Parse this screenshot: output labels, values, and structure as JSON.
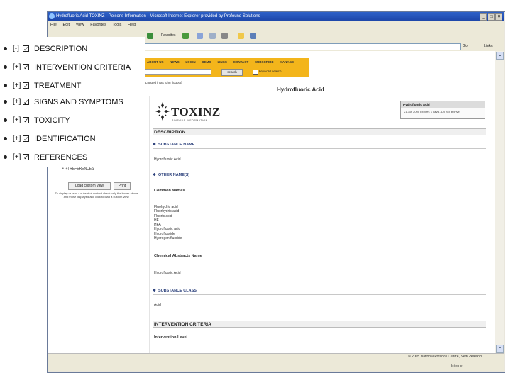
{
  "window": {
    "title": "Hydrofluoric Acid TOXINZ - Poisons Information - Microsoft Internet Explorer provided by Profound Solutions",
    "controls": [
      "_",
      "□",
      "X"
    ]
  },
  "menubar": [
    "File",
    "Edit",
    "View",
    "Favorites",
    "Tools",
    "Help"
  ],
  "toolbar": {
    "favorites": "Favorites"
  },
  "addressbar": {
    "go": "Go",
    "links": "Links"
  },
  "site_nav": [
    "ABOUT US",
    "NEWS",
    "LOGIN",
    "DEMO",
    "LINKS",
    "CONTACT",
    "SUBSCRIBE",
    "MANAGE"
  ],
  "search": {
    "button": "search",
    "keyword_label": "keyword search"
  },
  "logged_in": "Logged in as john [logout]",
  "page_title": "Hydrofluoric Acid",
  "left_panel": {
    "last_item_prefix": "[+]",
    "last_item_label": "REFERENCES",
    "load_button": "Load custom view",
    "print_button": "Print",
    "help_text": "To display or print a subset of content check only the boxes above and those displayed and click to load a custom view."
  },
  "overlay": {
    "items": [
      {
        "expander": "[-]",
        "label": "DESCRIPTION",
        "checked": true
      },
      {
        "expander": "[+]",
        "label": "INTERVENTION CRITERIA",
        "checked": true
      },
      {
        "expander": "[+]",
        "label": "TREATMENT",
        "checked": true
      },
      {
        "expander": "[+]",
        "label": "SIGNS AND SYMPTOMS",
        "checked": true
      },
      {
        "expander": "[+]",
        "label": "TOXICITY",
        "checked": true
      },
      {
        "expander": "[+]",
        "label": "IDENTIFICATION",
        "checked": true
      },
      {
        "expander": "[+]",
        "label": "REFERENCES",
        "checked": true
      }
    ]
  },
  "document": {
    "logo_text": "TOXINZ",
    "logo_subtext": "POISONS INFORMATION",
    "info_box": {
      "title": "Hydrofluoric Acid",
      "detail": "21 Jan 2005 Expires 7 days - Do not archive"
    },
    "description_header": "DESCRIPTION",
    "substance_name_header": "SUBSTANCE NAME",
    "substance_name": "Hydrofluoric Acid",
    "other_names_header": "OTHER NAME(S)",
    "common_names_label": "Common Names",
    "common_names": [
      "Fluohydric acid",
      "Fluorhydric acid",
      "Fluoric acid",
      "HF",
      "HFA",
      "Hydrofluoric acid",
      "Hydrofluoride",
      "Hydrogen fluoride"
    ],
    "cas_name_label": "Chemical Abstracts Name",
    "cas_name": "Hydrofluoric Acid",
    "substance_class_header": "SUBSTANCE CLASS",
    "substance_class": "Acid",
    "intervention_header": "INTERVENTION CRITERIA",
    "intervention_level_label": "Intervention Level"
  },
  "footer": {
    "copyright": "© 2005 National Poisons Centre, New Zealand",
    "zone": "Internet"
  },
  "colors": {
    "titlebar": "#1c44a7",
    "site_nav": "#f3b51b",
    "subheading": "#2a3f7a"
  }
}
